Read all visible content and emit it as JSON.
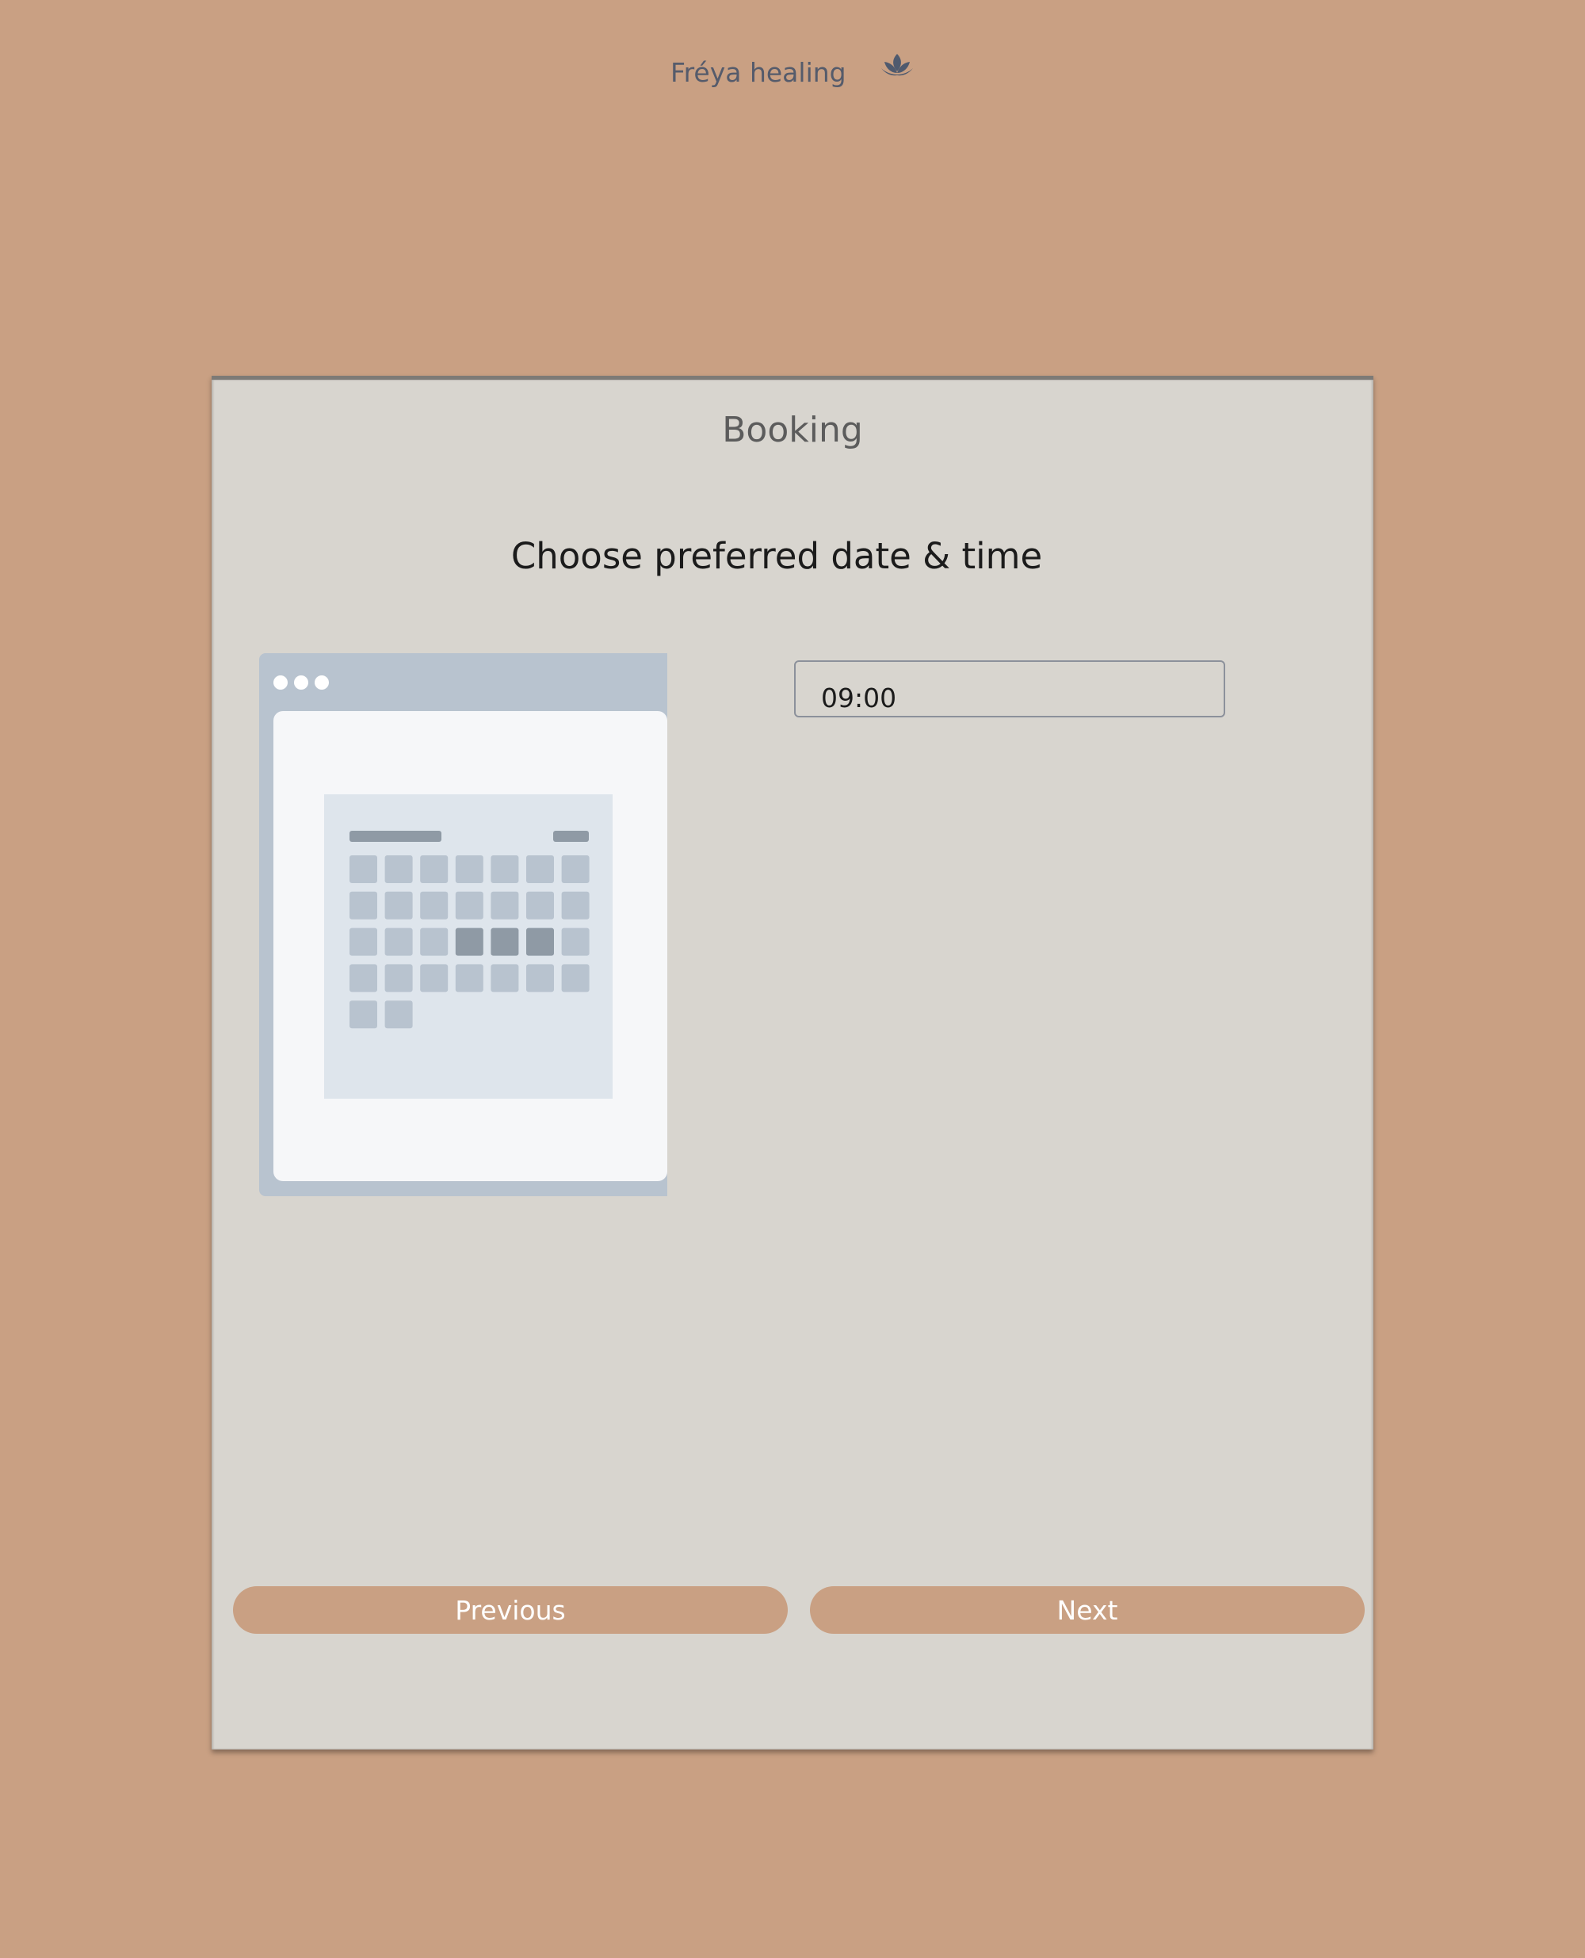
{
  "header": {
    "brand_name": "Fréya healing",
    "logo_icon": "lotus-icon",
    "logo_color": "#4f5a6e"
  },
  "booking": {
    "title": "Booking",
    "step_heading": "Choose preferred date & time",
    "illustration_icon": "calendar-illustration",
    "time_value": "09:00",
    "previous_label": "Previous",
    "next_label": "Next"
  },
  "colors": {
    "page_background": "#c9a083",
    "card_background": "#d8d5cf",
    "button_background": "#c9a083",
    "button_text": "#ffffff"
  }
}
